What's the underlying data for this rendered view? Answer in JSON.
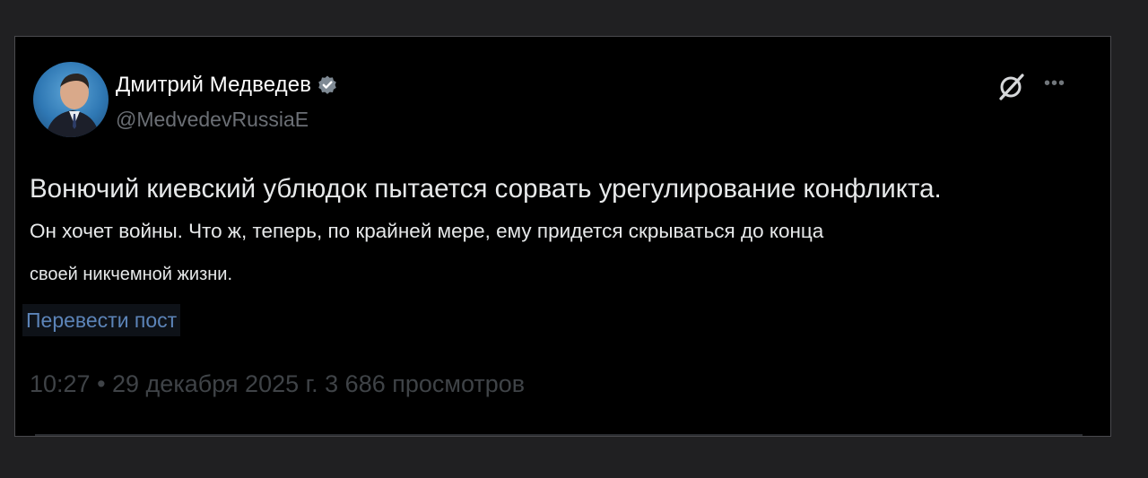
{
  "post": {
    "author": {
      "display_name": "Дмитрий Медведев",
      "handle": "@MedvedevRussiaE",
      "verified": true
    },
    "text": {
      "line1": "Вонючий киевский ублюдок пытается сорвать урегулирование конфликта.",
      "line2": "Он хочет войны. Что ж, теперь, по крайней мере, ему придется скрываться до конца",
      "line3": "своей никчемной жизни."
    },
    "translate_label": "Перевести пост",
    "meta": "10:27 • 29 декабря 2025 г. 3 686 просмотров"
  },
  "icons": {
    "verified": "verified-badge-icon",
    "grok": "grok-icon",
    "more": "more-options-icon"
  },
  "colors": {
    "background": "#000000",
    "outer_background": "#202022",
    "text": "#e7e9ea",
    "secondary_text": "#6b6f75",
    "link": "#5c84b8"
  }
}
